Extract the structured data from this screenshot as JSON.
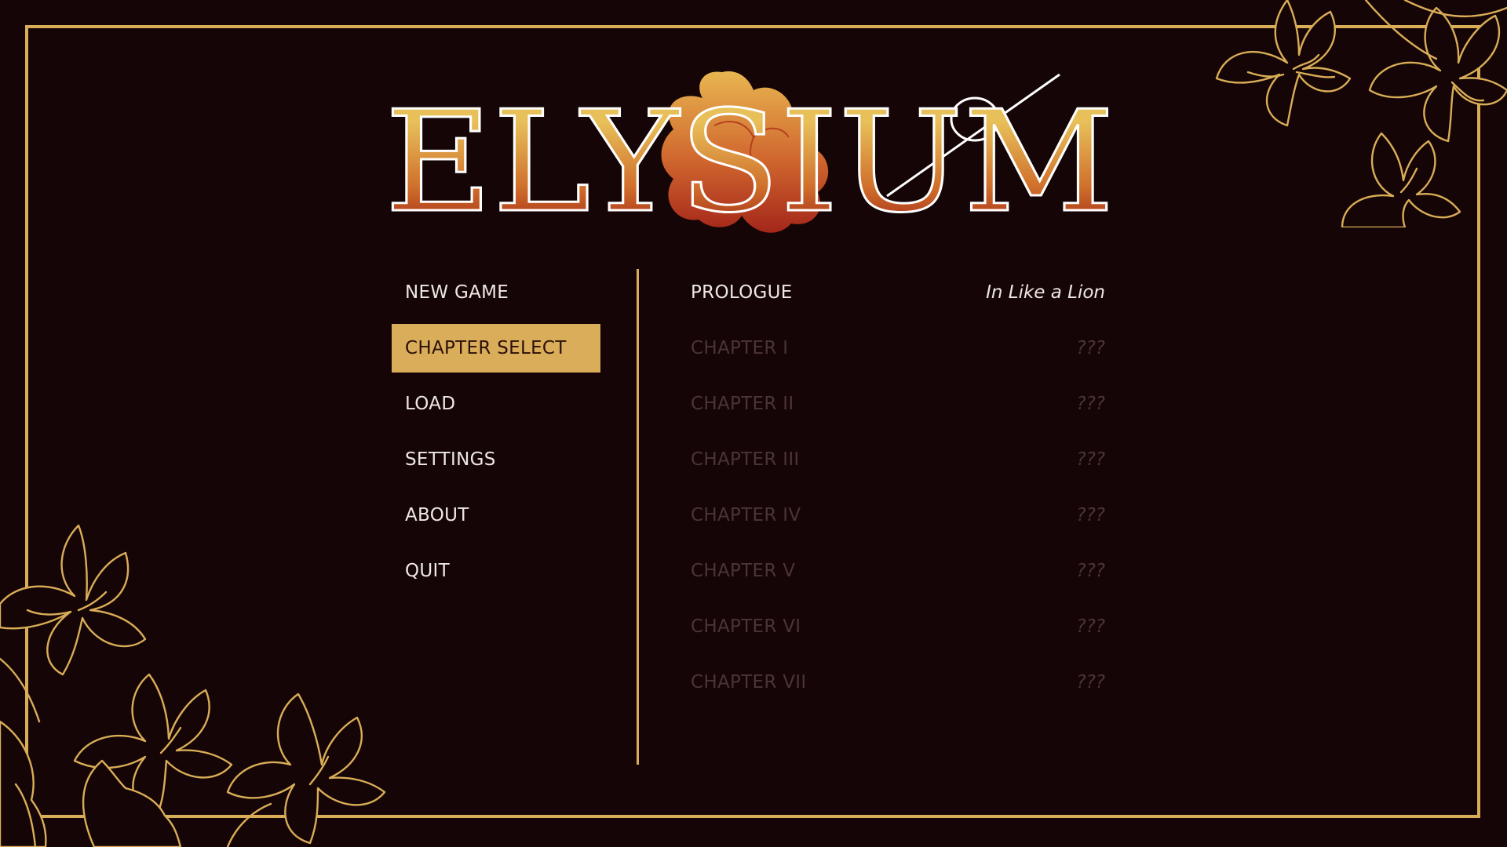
{
  "title": "ELYSIUM",
  "menu": {
    "items": [
      {
        "label": "NEW GAME",
        "active": false
      },
      {
        "label": "CHAPTER SELECT",
        "active": true
      },
      {
        "label": "LOAD",
        "active": false
      },
      {
        "label": "SETTINGS",
        "active": false
      },
      {
        "label": "ABOUT",
        "active": false
      },
      {
        "label": "QUIT",
        "active": false
      }
    ]
  },
  "chapters": [
    {
      "label": "PROLOGUE",
      "subtitle": "In Like a Lion",
      "locked": false
    },
    {
      "label": "CHAPTER I",
      "subtitle": "???",
      "locked": true
    },
    {
      "label": "CHAPTER II",
      "subtitle": "???",
      "locked": true
    },
    {
      "label": "CHAPTER III",
      "subtitle": "???",
      "locked": true
    },
    {
      "label": "CHAPTER IV",
      "subtitle": "???",
      "locked": true
    },
    {
      "label": "CHAPTER V",
      "subtitle": "???",
      "locked": true
    },
    {
      "label": "CHAPTER VI",
      "subtitle": "???",
      "locked": true
    },
    {
      "label": "CHAPTER VII",
      "subtitle": "???",
      "locked": true
    }
  ],
  "colors": {
    "background": "#150506",
    "accent_gold": "#d9ad58",
    "text": "#eee8e2",
    "locked_text": "#4c3436",
    "logo_top": "#e8c05a",
    "logo_bottom": "#a83018"
  },
  "icons": {
    "top_right_decoration": "orchid-flowers-outline",
    "bottom_left_decoration": "orchid-flowers-outline",
    "logo_emblem": "orchid-flower"
  }
}
